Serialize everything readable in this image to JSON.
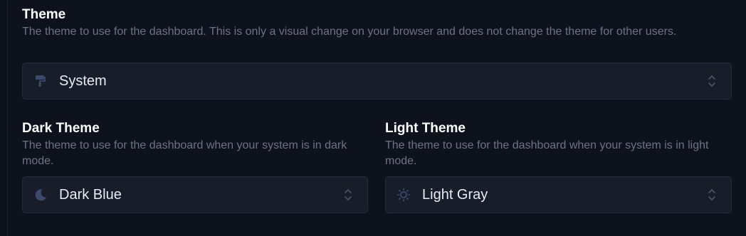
{
  "theme": {
    "title": "Theme",
    "description": "The theme to use for the dashboard. This is only a visual change on your browser and does not change the theme for other users.",
    "selected": "System",
    "icon": "paint-roller-icon"
  },
  "dark_theme": {
    "title": "Dark Theme",
    "description": "The theme to use for the dashboard when your system is in dark mode.",
    "selected": "Dark Blue",
    "icon": "moon-icon"
  },
  "light_theme": {
    "title": "Light Theme",
    "description": "The theme to use for the dashboard when your system is in light mode.",
    "selected": "Light Gray",
    "icon": "sun-icon"
  },
  "colors": {
    "background": "#0e121d",
    "select_bg": "#181d2a",
    "select_border": "#252c3b",
    "title": "#ffffff",
    "description": "#6b7385",
    "icon": "#3b4a6b"
  }
}
